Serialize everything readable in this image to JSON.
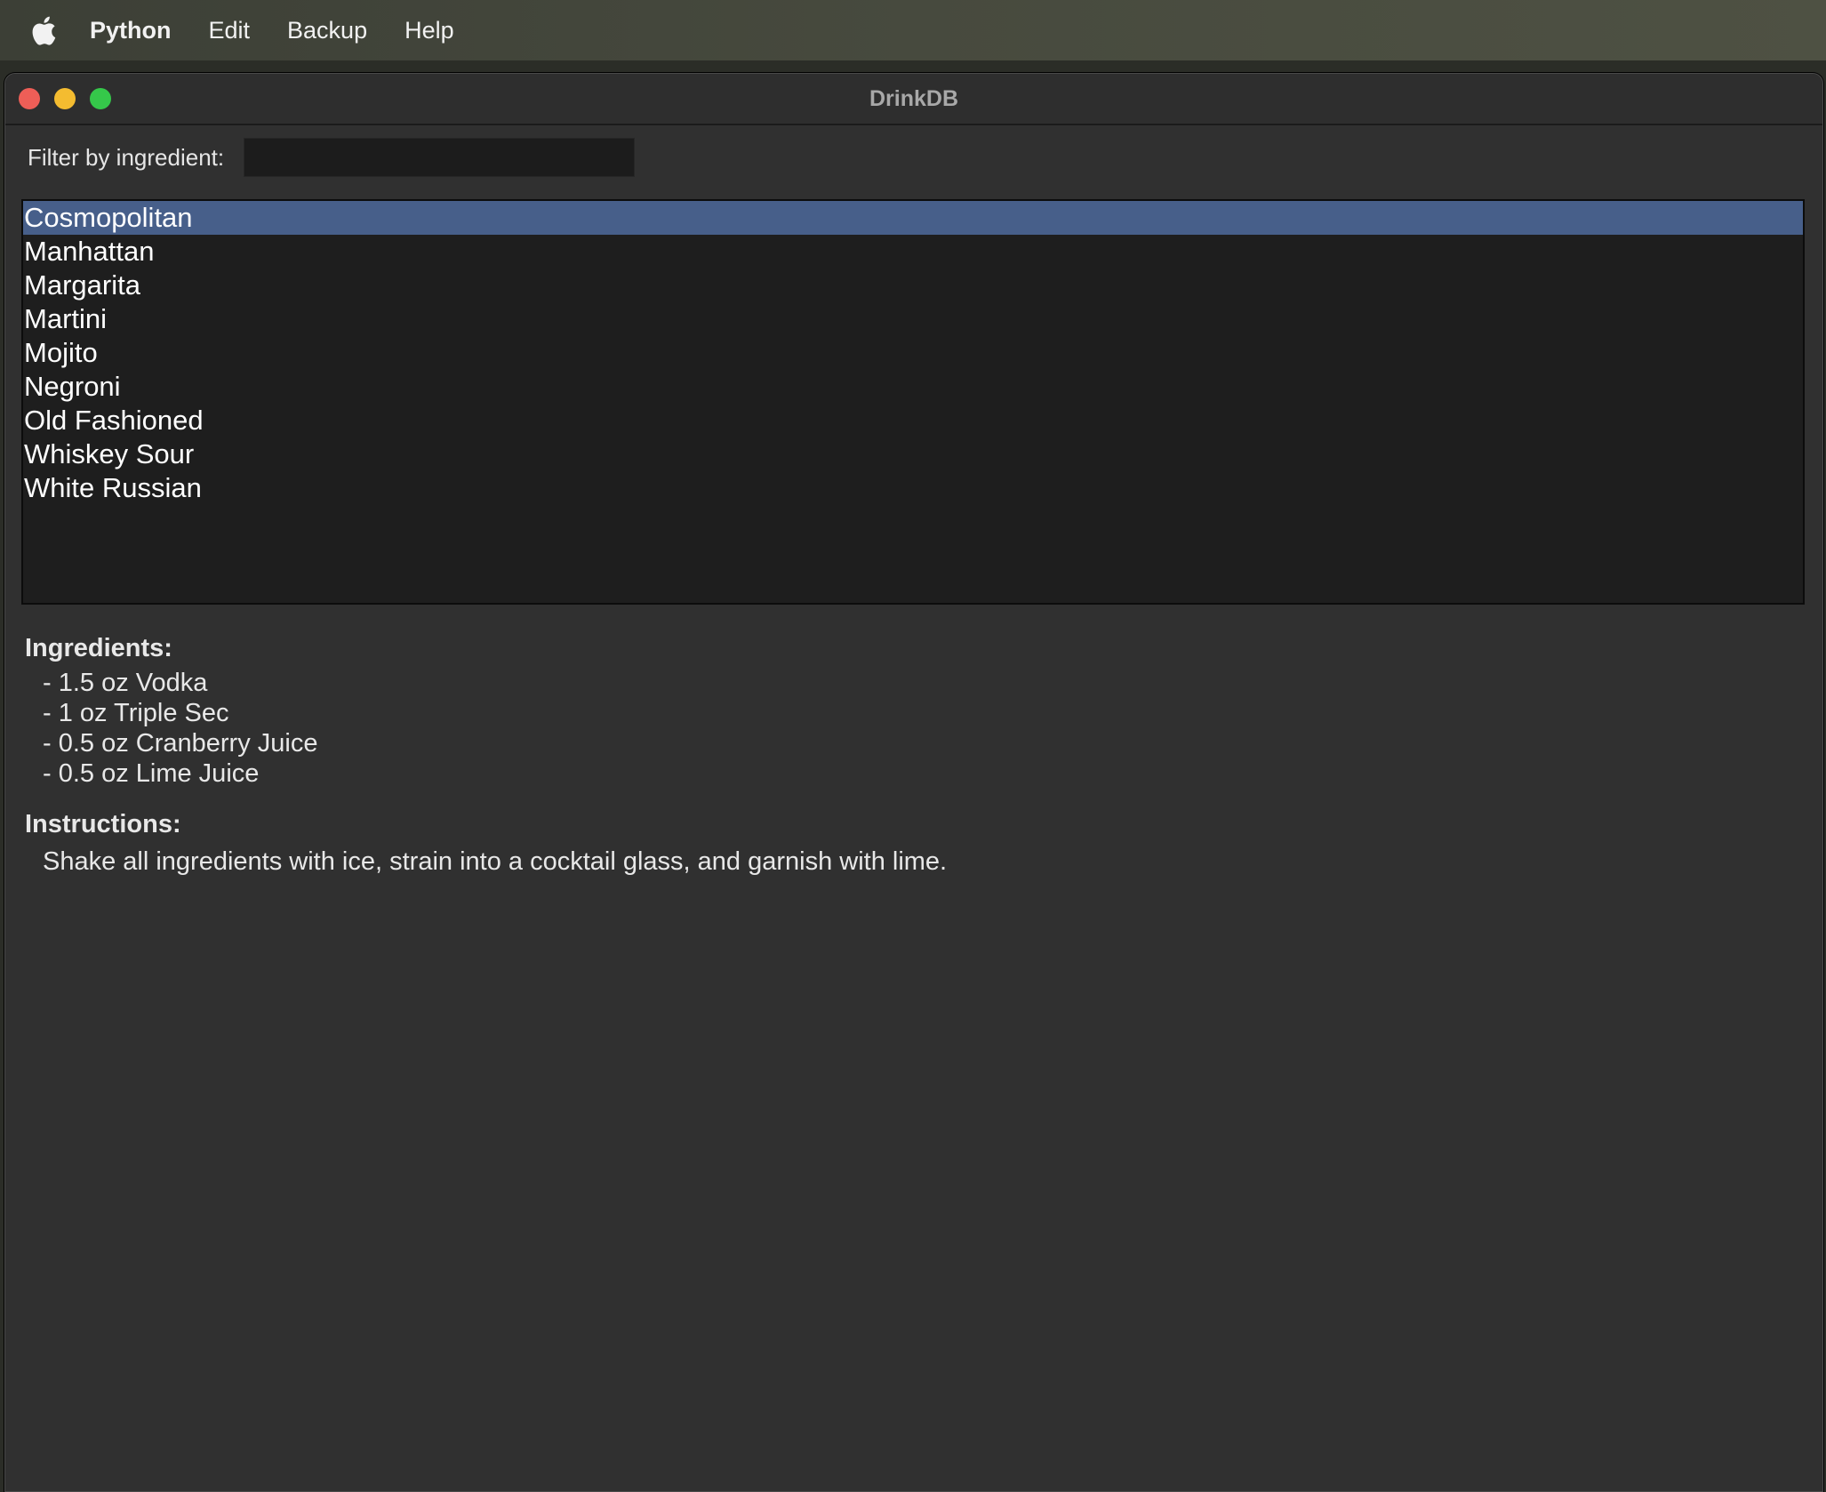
{
  "menubar": {
    "apple_icon": "apple-logo-icon",
    "items": [
      "Python",
      "Edit",
      "Backup",
      "Help"
    ]
  },
  "window": {
    "title": "DrinkDB",
    "traffic_colors": {
      "close": "#ee5e57",
      "minimize": "#f4bc30",
      "maximize": "#35c84a"
    }
  },
  "filter": {
    "label": "Filter by ingredient:",
    "value": ""
  },
  "drinks": {
    "items": [
      "Cosmopolitan",
      "Manhattan",
      "Margarita",
      "Martini",
      "Mojito",
      "Negroni",
      "Old Fashioned",
      "Whiskey Sour",
      "White Russian"
    ],
    "selected": "Cosmopolitan",
    "selection_color": "#475f8a"
  },
  "details": {
    "ingredients_title": "Ingredients:",
    "ingredients": [
      "- 1.5 oz Vodka",
      "- 1 oz Triple Sec",
      "- 0.5 oz Cranberry Juice",
      "- 0.5 oz Lime Juice"
    ],
    "instructions_title": "Instructions:",
    "instructions": "Shake all ingredients with ice, strain into a cocktail glass, and garnish with lime."
  }
}
